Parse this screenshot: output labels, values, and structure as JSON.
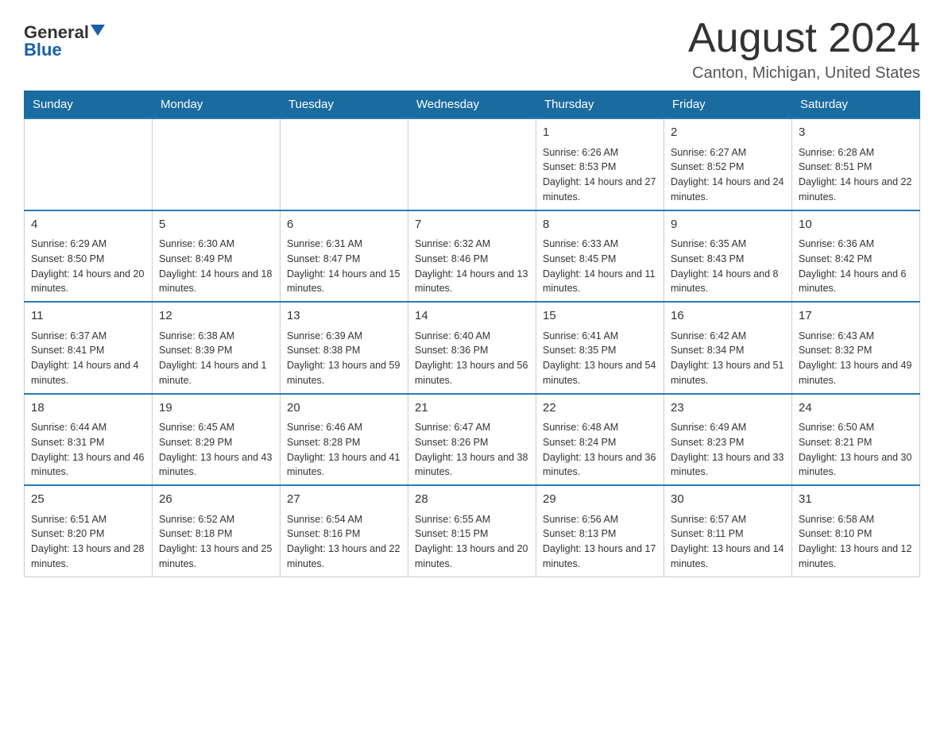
{
  "header": {
    "logo_general": "General",
    "logo_blue": "Blue",
    "month_title": "August 2024",
    "location": "Canton, Michigan, United States"
  },
  "weekdays": [
    "Sunday",
    "Monday",
    "Tuesday",
    "Wednesday",
    "Thursday",
    "Friday",
    "Saturday"
  ],
  "weeks": [
    [
      {
        "day": "",
        "info": ""
      },
      {
        "day": "",
        "info": ""
      },
      {
        "day": "",
        "info": ""
      },
      {
        "day": "",
        "info": ""
      },
      {
        "day": "1",
        "info": "Sunrise: 6:26 AM\nSunset: 8:53 PM\nDaylight: 14 hours and 27 minutes."
      },
      {
        "day": "2",
        "info": "Sunrise: 6:27 AM\nSunset: 8:52 PM\nDaylight: 14 hours and 24 minutes."
      },
      {
        "day": "3",
        "info": "Sunrise: 6:28 AM\nSunset: 8:51 PM\nDaylight: 14 hours and 22 minutes."
      }
    ],
    [
      {
        "day": "4",
        "info": "Sunrise: 6:29 AM\nSunset: 8:50 PM\nDaylight: 14 hours and 20 minutes."
      },
      {
        "day": "5",
        "info": "Sunrise: 6:30 AM\nSunset: 8:49 PM\nDaylight: 14 hours and 18 minutes."
      },
      {
        "day": "6",
        "info": "Sunrise: 6:31 AM\nSunset: 8:47 PM\nDaylight: 14 hours and 15 minutes."
      },
      {
        "day": "7",
        "info": "Sunrise: 6:32 AM\nSunset: 8:46 PM\nDaylight: 14 hours and 13 minutes."
      },
      {
        "day": "8",
        "info": "Sunrise: 6:33 AM\nSunset: 8:45 PM\nDaylight: 14 hours and 11 minutes."
      },
      {
        "day": "9",
        "info": "Sunrise: 6:35 AM\nSunset: 8:43 PM\nDaylight: 14 hours and 8 minutes."
      },
      {
        "day": "10",
        "info": "Sunrise: 6:36 AM\nSunset: 8:42 PM\nDaylight: 14 hours and 6 minutes."
      }
    ],
    [
      {
        "day": "11",
        "info": "Sunrise: 6:37 AM\nSunset: 8:41 PM\nDaylight: 14 hours and 4 minutes."
      },
      {
        "day": "12",
        "info": "Sunrise: 6:38 AM\nSunset: 8:39 PM\nDaylight: 14 hours and 1 minute."
      },
      {
        "day": "13",
        "info": "Sunrise: 6:39 AM\nSunset: 8:38 PM\nDaylight: 13 hours and 59 minutes."
      },
      {
        "day": "14",
        "info": "Sunrise: 6:40 AM\nSunset: 8:36 PM\nDaylight: 13 hours and 56 minutes."
      },
      {
        "day": "15",
        "info": "Sunrise: 6:41 AM\nSunset: 8:35 PM\nDaylight: 13 hours and 54 minutes."
      },
      {
        "day": "16",
        "info": "Sunrise: 6:42 AM\nSunset: 8:34 PM\nDaylight: 13 hours and 51 minutes."
      },
      {
        "day": "17",
        "info": "Sunrise: 6:43 AM\nSunset: 8:32 PM\nDaylight: 13 hours and 49 minutes."
      }
    ],
    [
      {
        "day": "18",
        "info": "Sunrise: 6:44 AM\nSunset: 8:31 PM\nDaylight: 13 hours and 46 minutes."
      },
      {
        "day": "19",
        "info": "Sunrise: 6:45 AM\nSunset: 8:29 PM\nDaylight: 13 hours and 43 minutes."
      },
      {
        "day": "20",
        "info": "Sunrise: 6:46 AM\nSunset: 8:28 PM\nDaylight: 13 hours and 41 minutes."
      },
      {
        "day": "21",
        "info": "Sunrise: 6:47 AM\nSunset: 8:26 PM\nDaylight: 13 hours and 38 minutes."
      },
      {
        "day": "22",
        "info": "Sunrise: 6:48 AM\nSunset: 8:24 PM\nDaylight: 13 hours and 36 minutes."
      },
      {
        "day": "23",
        "info": "Sunrise: 6:49 AM\nSunset: 8:23 PM\nDaylight: 13 hours and 33 minutes."
      },
      {
        "day": "24",
        "info": "Sunrise: 6:50 AM\nSunset: 8:21 PM\nDaylight: 13 hours and 30 minutes."
      }
    ],
    [
      {
        "day": "25",
        "info": "Sunrise: 6:51 AM\nSunset: 8:20 PM\nDaylight: 13 hours and 28 minutes."
      },
      {
        "day": "26",
        "info": "Sunrise: 6:52 AM\nSunset: 8:18 PM\nDaylight: 13 hours and 25 minutes."
      },
      {
        "day": "27",
        "info": "Sunrise: 6:54 AM\nSunset: 8:16 PM\nDaylight: 13 hours and 22 minutes."
      },
      {
        "day": "28",
        "info": "Sunrise: 6:55 AM\nSunset: 8:15 PM\nDaylight: 13 hours and 20 minutes."
      },
      {
        "day": "29",
        "info": "Sunrise: 6:56 AM\nSunset: 8:13 PM\nDaylight: 13 hours and 17 minutes."
      },
      {
        "day": "30",
        "info": "Sunrise: 6:57 AM\nSunset: 8:11 PM\nDaylight: 13 hours and 14 minutes."
      },
      {
        "day": "31",
        "info": "Sunrise: 6:58 AM\nSunset: 8:10 PM\nDaylight: 13 hours and 12 minutes."
      }
    ]
  ]
}
